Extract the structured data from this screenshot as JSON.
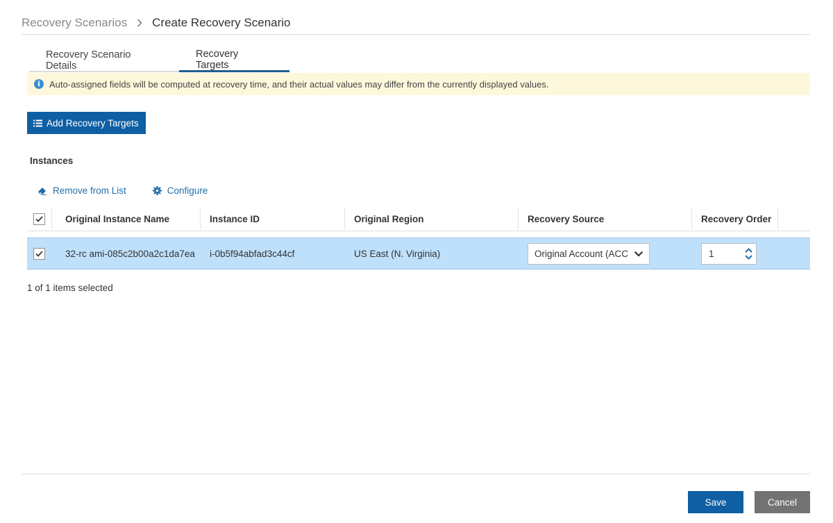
{
  "breadcrumb": {
    "parent": "Recovery Scenarios",
    "current": "Create Recovery Scenario"
  },
  "tabs": [
    {
      "label": "Recovery Scenario Details",
      "active": false
    },
    {
      "label": "Recovery Targets",
      "active": true
    }
  ],
  "info_banner": {
    "icon": "info-icon",
    "text": "Auto-assigned fields will be computed at recovery time, and their actual values may differ from the currently displayed values."
  },
  "toolbar": {
    "add_label": "Add Recovery Targets"
  },
  "instances": {
    "title": "Instances",
    "actions": {
      "remove_label": "Remove from List",
      "configure_label": "Configure"
    },
    "columns": [
      "Original Instance Name",
      "Instance ID",
      "Original Region",
      "Recovery Source",
      "Recovery Order"
    ],
    "header_checked": true,
    "rows": [
      {
        "checked": true,
        "name": "32-rc ami-085c2b00a2c1da7ea",
        "instance_id": "i-0b5f94abfad3c44cf",
        "region": "US East (N. Virginia)",
        "recovery_source": "Original Account (ACC",
        "recovery_order": "1"
      }
    ],
    "selected_text": "1 of 1 items selected"
  },
  "footer": {
    "save_label": "Save",
    "cancel_label": "Cancel"
  },
  "colors": {
    "primary": "#0e5fa3",
    "selected_row": "#bfe0fb",
    "banner": "#fdf8db",
    "link": "#1f6fa8",
    "cancel": "#737373"
  }
}
